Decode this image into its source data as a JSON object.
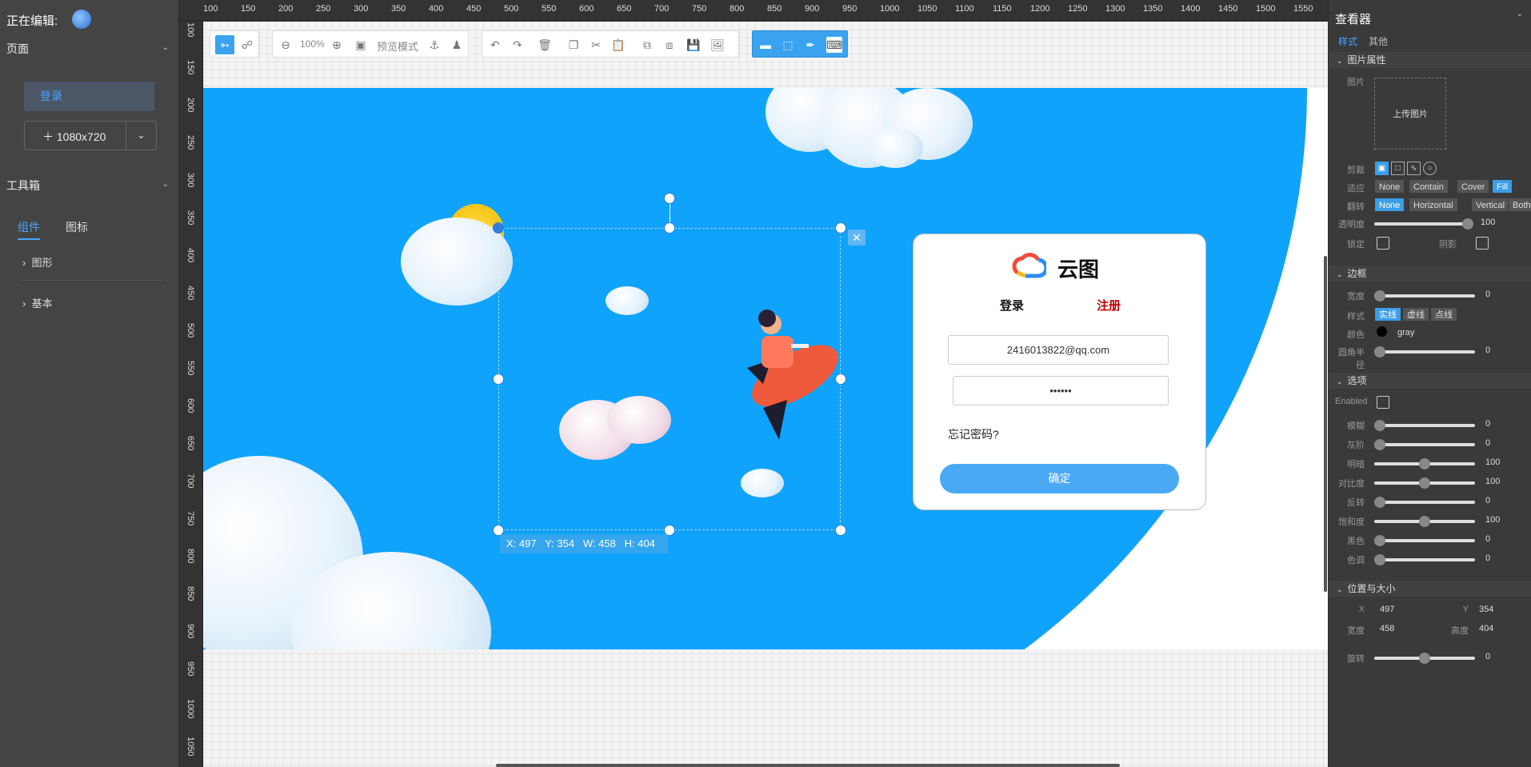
{
  "left": {
    "editing_label": "正在编辑:",
    "page_section": "页面",
    "page_item": "登录",
    "size_label": "1080x720",
    "toolbox_section": "工具箱",
    "tabs": [
      "组件",
      "图标"
    ],
    "tree": [
      "图形",
      "基本"
    ]
  },
  "ruler": {
    "top": [
      "100",
      "150",
      "200",
      "250",
      "300",
      "350",
      "400",
      "450",
      "500",
      "550",
      "600",
      "650",
      "700",
      "750",
      "800",
      "850",
      "900",
      "950",
      "1000",
      "1050",
      "1100",
      "1150",
      "1200",
      "1250",
      "1300",
      "1350",
      "1400",
      "1450",
      "1500",
      "1550"
    ],
    "left": [
      "100",
      "150",
      "200",
      "250",
      "300",
      "350",
      "400",
      "450",
      "500",
      "550",
      "600",
      "650",
      "700",
      "750",
      "800",
      "850",
      "900",
      "950",
      "1000",
      "1050"
    ]
  },
  "toolbar": {
    "zoom": "100%",
    "preview_label": "预览模式"
  },
  "login": {
    "brand": "云图",
    "tab_login": "登录",
    "tab_register": "注册",
    "email_value": "2416013822@qq.com",
    "password_value": "••••••",
    "forgot": "忘记密码?",
    "submit": "确定"
  },
  "selection": {
    "coords": "X: 497   Y: 354   W: 458   H: 404"
  },
  "inspector": {
    "title": "查看器",
    "tab_style": "样式",
    "tab_other": "其他",
    "image_props": {
      "section": "图片属性",
      "image_label": "图片",
      "upload": "上传图片",
      "crop_label": "剪裁",
      "fit_label": "适应",
      "fit_options": [
        "None",
        "Contain",
        "Cover",
        "Fill"
      ],
      "flip_label": "翻转",
      "flip_options": [
        "None",
        "Horizontal",
        "Vertical",
        "Both"
      ],
      "opacity_label": "透明度",
      "opacity_value": "100",
      "lock_label": "锁定",
      "shadow_label": "阴影"
    },
    "border": {
      "section": "边框",
      "width_label": "宽度",
      "width_value": "0",
      "style_label": "样式",
      "style_options": [
        "实线",
        "虚线",
        "点线"
      ],
      "color_label": "颜色",
      "color_value": "gray",
      "radius_label": "圆角半径",
      "radius_value": "0"
    },
    "options": {
      "section": "选项",
      "enabled_label": "Enabled",
      "filters": [
        {
          "label": "模糊",
          "value": "0",
          "pos": 0
        },
        {
          "label": "灰阶",
          "value": "0",
          "pos": 0
        },
        {
          "label": "明暗",
          "value": "100",
          "pos": 0.5
        },
        {
          "label": "对比度",
          "value": "100",
          "pos": 0.5
        },
        {
          "label": "反转",
          "value": "0",
          "pos": 0
        },
        {
          "label": "饱和度",
          "value": "100",
          "pos": 0.5
        },
        {
          "label": "黑色",
          "value": "0",
          "pos": 0
        },
        {
          "label": "色调",
          "value": "0",
          "pos": 0
        }
      ]
    },
    "position": {
      "section": "位置与大小",
      "x_label": "X",
      "x_value": "497",
      "y_label": "Y",
      "y_value": "354",
      "w_label": "宽度",
      "w_value": "458",
      "h_label": "高度",
      "h_value": "404",
      "rotate_label": "旋转",
      "rotate_value": "0"
    }
  },
  "colors": {
    "accent": "#3a9ee8",
    "canvas_blue": "#10a3fb",
    "register_red": "#c00000"
  }
}
